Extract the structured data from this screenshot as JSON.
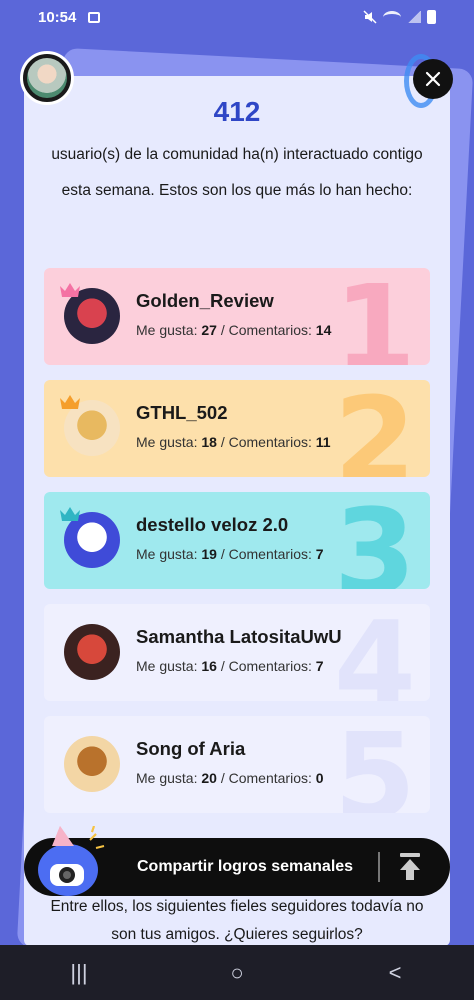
{
  "status_bar": {
    "time": "10:54"
  },
  "header": {
    "count": "412",
    "intro": "usuario(s) de la comunidad ha(n) interactuado contigo esta semana. Estos son los que más lo han hecho:"
  },
  "leaders": [
    {
      "rank": "1",
      "name": "Golden_Review",
      "likes_label": "Me gusta:",
      "likes": "27",
      "comments_label": "Comentarios:",
      "comments": "14",
      "bg": "#fccfdb",
      "num_color": "#f8a9bf",
      "crown": "#f472a3"
    },
    {
      "rank": "2",
      "name": "GTHL_502",
      "likes_label": "Me gusta:",
      "likes": "18",
      "comments_label": "Comentarios:",
      "comments": "11",
      "bg": "#fde0ab",
      "num_color": "#fcc978",
      "crown": "#f59e2b"
    },
    {
      "rank": "3",
      "name": "destello veloz 2.0",
      "likes_label": "Me gusta:",
      "likes": "19",
      "comments_label": "Comentarios:",
      "comments": "7",
      "bg": "#9fe9ee",
      "num_color": "#5fd6de",
      "crown": "#2fb5c3"
    },
    {
      "rank": "4",
      "name": "Samantha LatositaUwU",
      "likes_label": "Me gusta:",
      "likes": "16",
      "comments_label": "Comentarios:",
      "comments": "7",
      "bg": "#eff0fe",
      "num_color": "#e1e3fb",
      "crown": ""
    },
    {
      "rank": "5",
      "name": "Song of Aria",
      "likes_label": "Me gusta:",
      "likes": "20",
      "comments_label": "Comentarios:",
      "comments": "0",
      "bg": "#eff0fe",
      "num_color": "#e1e3fb",
      "crown": ""
    }
  ],
  "share": {
    "label": "Compartir logros semanales"
  },
  "footer": {
    "text": "Entre ellos, los siguientes fieles seguidores todavía no son tus amigos. ¿Quieres seguirlos?"
  },
  "nav": {
    "recent": "|||",
    "home": "○",
    "back": "<"
  }
}
